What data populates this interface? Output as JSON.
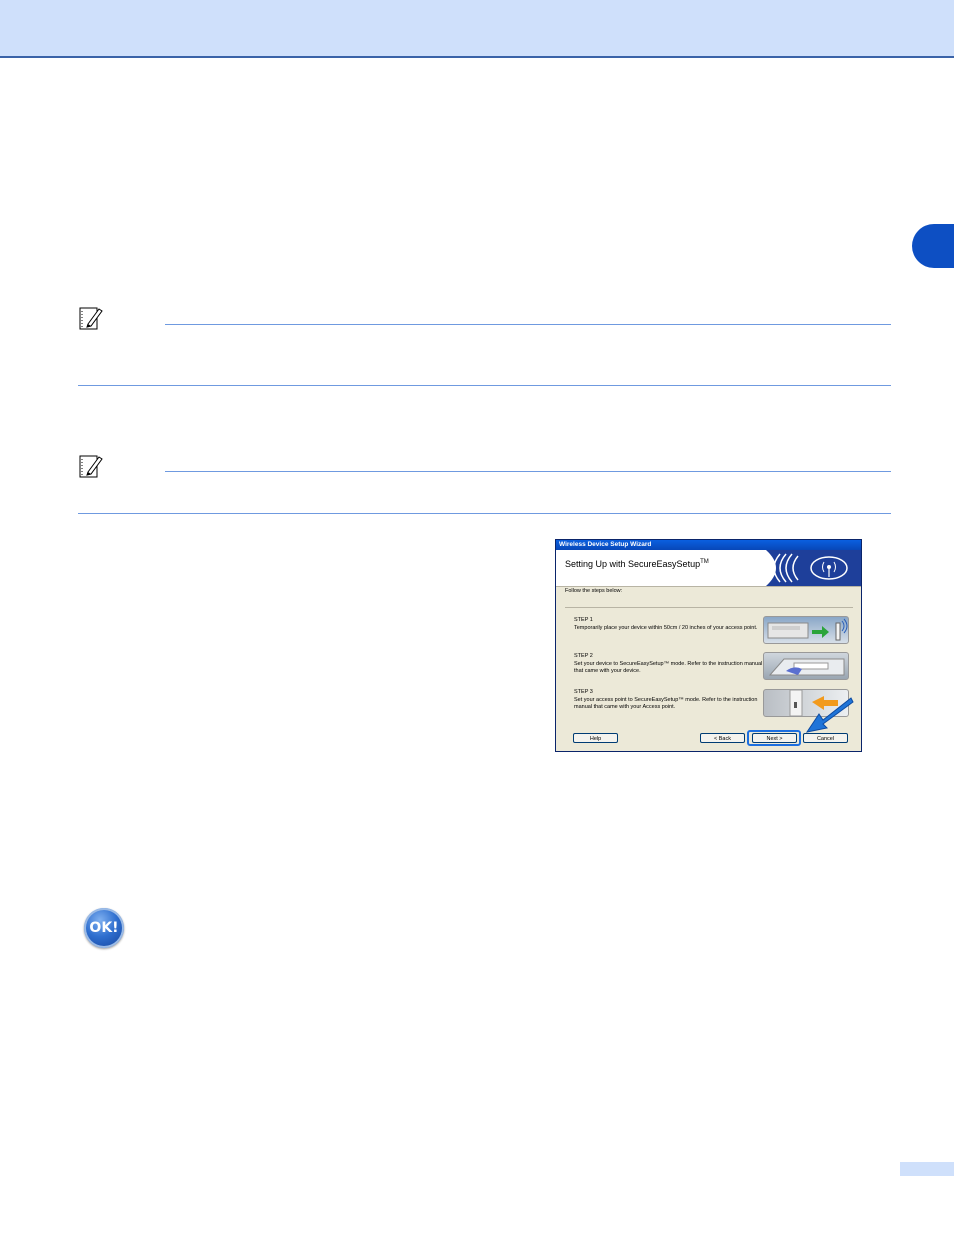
{
  "dialog": {
    "title": "Wireless Device Setup Wizard",
    "heading": "Setting Up with SecureEasySetup",
    "heading_mark": "TM",
    "intro": "Follow the steps below:",
    "steps": [
      {
        "label": "STEP 1",
        "text": "Temporarily place your device within 50cm / 20 inches of your access point."
      },
      {
        "label": "STEP 2",
        "text": "Set your device to SecureEasySetup™ mode. Refer to the instruction manual that came with your device."
      },
      {
        "label": "STEP 3",
        "text": "Set your access point to SecureEasySetup™ mode. Refer to the instruction manual that came with your Access point."
      }
    ],
    "buttons": {
      "help": "Help",
      "back": "< Back",
      "next": "Next >",
      "cancel": "Cancel"
    }
  },
  "ok_badge": "OK!",
  "colors": {
    "header_band": "#cfe0fb",
    "header_rule": "#3a63a8",
    "chapter_tab": "#0d4fc3",
    "note_rule": "#6f9ae0"
  }
}
